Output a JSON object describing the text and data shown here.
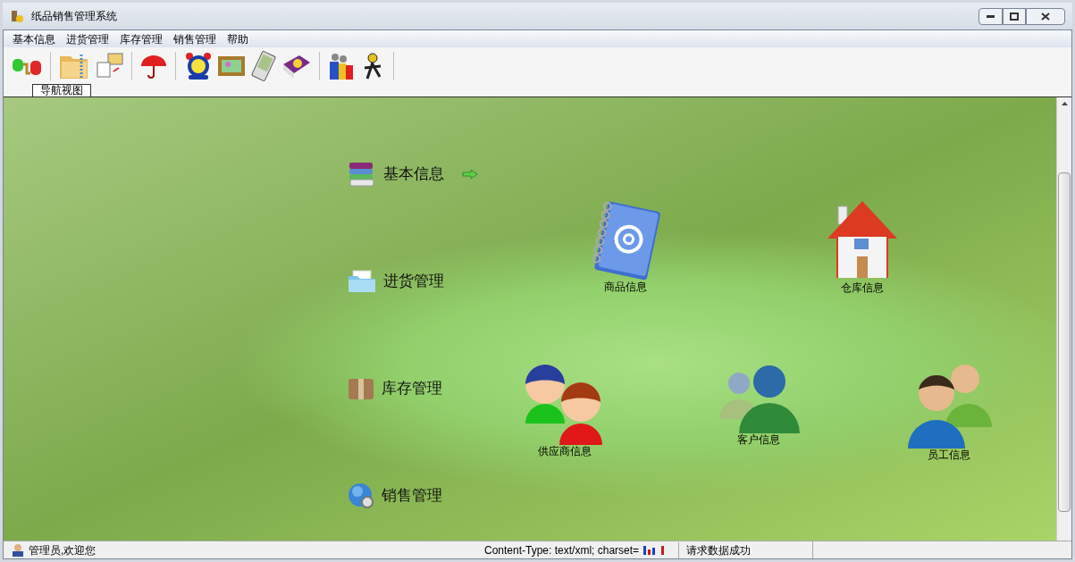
{
  "window": {
    "title": "纸品销售管理系统"
  },
  "menu": [
    "基本信息",
    "进货管理",
    "库存管理",
    "销售管理",
    "帮助"
  ],
  "tab": {
    "label": "导航视图",
    "selected": true
  },
  "nav": [
    {
      "label": "基本信息",
      "kind": "books",
      "selected": true
    },
    {
      "label": "进货管理",
      "kind": "folder",
      "selected": false
    },
    {
      "label": "库存管理",
      "kind": "box",
      "selected": false
    },
    {
      "label": "销售管理",
      "kind": "globe",
      "selected": false
    }
  ],
  "modules": [
    {
      "label": "商品信息",
      "kind": "addressbook"
    },
    {
      "label": "仓库信息",
      "kind": "house"
    },
    {
      "label": "供应商信息",
      "kind": "pair"
    },
    {
      "label": "客户信息",
      "kind": "group"
    },
    {
      "label": "员工信息",
      "kind": "staff"
    }
  ],
  "status_bar": {
    "user": "管理员,欢迎您",
    "content_type": "Content-Type: text/xml; charset=",
    "message": "请求数据成功"
  }
}
